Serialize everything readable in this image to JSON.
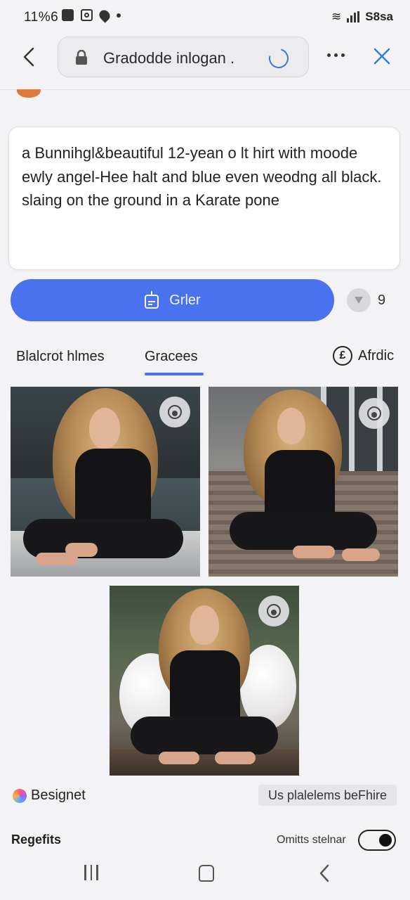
{
  "status_bar": {
    "time": "11%6",
    "battery": "S8sa"
  },
  "top_bar": {
    "url": "Gradodde inlogan",
    "url_suffix": "."
  },
  "prompt": {
    "text": "a Bunnihgl&beautiful 12-yean o lt hirt with moode ewly angel-Hee halt and blue even weodng all black. slaing on the ground in a Karate pone"
  },
  "generate_button": {
    "label": "Grler"
  },
  "side_button": {
    "label": "9"
  },
  "tabs": {
    "left": "Blalcrot hlmes",
    "active": "Gracees",
    "right": "Afrdic"
  },
  "footer": {
    "brand": "Besignet",
    "chip": "Us plalelems beFhire",
    "left_label": "Regefits",
    "toggle_label": "Omitts stelnar"
  },
  "colors": {
    "accent": "#4a72ee",
    "spinner": "#3b78d8"
  },
  "icons": [
    "back-arrow-icon",
    "lock-icon",
    "loading-spinner-icon",
    "more-dots-icon",
    "close-icon",
    "wand-icon",
    "e-circle-icon",
    "badge-icon",
    "nav-recents-icon",
    "nav-home-icon",
    "nav-back-icon"
  ]
}
